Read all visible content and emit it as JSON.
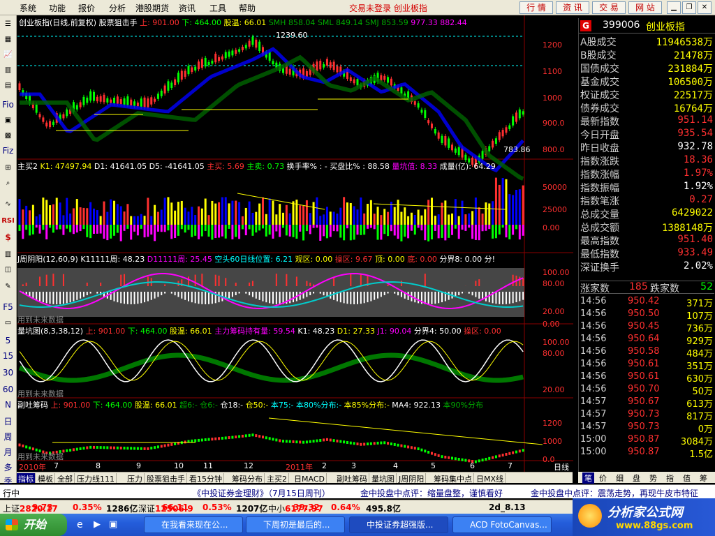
{
  "menu": [
    "系统",
    "功能",
    "报价",
    "分析",
    "港股期货",
    "资讯",
    "工具",
    "帮助"
  ],
  "status_center": "交易未登录  创业板指",
  "top_buttons": [
    "行 情",
    "资 讯",
    "交 易",
    "网 站"
  ],
  "left_toolbar": [
    "Fio",
    "Fiz",
    "RSI",
    "$",
    "F5",
    "5",
    "15",
    "30",
    "60",
    "N",
    "日",
    "周",
    "月",
    "多",
    "季"
  ],
  "panels": {
    "p1": {
      "title": "创业板指(日线,前复权)",
      "indicator": "股票狙击手",
      "up": "上: 901.00",
      "down": "下: 464.00",
      "mid": "股温: 66.01",
      "smh": "SMH 858.04",
      "sml": "SML 849.14",
      "smj": "SMJ 853.59",
      "v1": "977.33",
      "v2": "882.44",
      "high_label": "1239.60",
      "low_label": "783.86"
    },
    "p2": {
      "title": "主买2",
      "k1": "K1: 47497.94",
      "d1": "D1: 41641.05",
      "d5": "D5: -41641.05",
      "zm": "主买: 5.69",
      "zmai": "主卖: 0.73",
      "hsl": "换手率% : -",
      "mpb": "买盘比% : 88.58",
      "lkz": "量坑值: 8.33",
      "cl": "成量(亿): 64.29"
    },
    "p3": {
      "title": "J周阴阳(12,60,9)",
      "k": "K11111周: 48.23",
      "d": "D11111周: 25.45",
      "kt": "空头60日线位置: 6.21",
      "gq": "观区: 0.00",
      "cq": "操区: 9.67",
      "ding": "顶: 0.00",
      "di": "底: 0.00",
      "fj": "分界8: 0.00",
      "fen": "分!",
      "note": "用到未来数据"
    },
    "p4": {
      "title": "量坑图(8,3,38,12)",
      "up": "上: 901.00",
      "down": "下: 464.00",
      "mid": "股温: 66.01",
      "zl": "主力筹码持有量: 59.54",
      "k1": "K1: 48.23",
      "d1": "D1: 27.33",
      "j1": "J1: 90.04",
      "fj": "分界4: 50.00",
      "cq": "操区: 0.00",
      "note": "用到未来数据"
    },
    "p5": {
      "title": "副吐筹码",
      "up": "上: 901.00",
      "down": "下: 464.00",
      "mid": "股温: 66.01",
      "c1": "超6:-",
      "c2": "仓6:-",
      "c3": "仓18:-",
      "c4": "仓50:-",
      "c5": "本75:-",
      "c6": "本80%分布:-",
      "c7": "本85%分布:-",
      "ma": "MA4: 922.13",
      "c8": "本90%分布",
      "note": "用到未来数据"
    }
  },
  "y_axis": {
    "p1": [
      "1200",
      "1100",
      "1000",
      "900.0",
      "800.0"
    ],
    "p2": [
      "50000",
      "25000",
      "0.00"
    ],
    "p3": [
      "100.00",
      "80.00",
      "20.00",
      "0.00"
    ],
    "p4": [
      "100.00",
      "80.00",
      "20.00"
    ],
    "p5": [
      "1200",
      "1000",
      "0.0"
    ]
  },
  "x_axis": {
    "year": "2010年",
    "labels": [
      "7",
      "8",
      "9",
      "10",
      "11",
      "12",
      "2011年",
      "2",
      "3",
      "4",
      "5",
      "6",
      "7"
    ],
    "period": "日线"
  },
  "index_panel": {
    "header_icon": "G",
    "code": "399006",
    "name": "创业板指",
    "rows": [
      {
        "k": "A股成交",
        "v": "11946538万",
        "c": "#ffff00"
      },
      {
        "k": "B股成交",
        "v": "21478万",
        "c": "#ffff00"
      },
      {
        "k": "国债成交",
        "v": "231884万",
        "c": "#ffff00"
      },
      {
        "k": "基金成交",
        "v": "106500万",
        "c": "#ffff00"
      },
      {
        "k": "权证成交",
        "v": "22517万",
        "c": "#ffff00"
      },
      {
        "k": "债券成交",
        "v": "16764万",
        "c": "#ffff00"
      },
      {
        "k": "最新指数",
        "v": "951.14",
        "c": "#ff3030"
      },
      {
        "k": "今日开盘",
        "v": "935.54",
        "c": "#ff3030"
      },
      {
        "k": "昨日收盘",
        "v": "932.78",
        "c": "#ffffff"
      },
      {
        "k": "指数涨跌",
        "v": "18.36",
        "c": "#ff3030"
      },
      {
        "k": "指数涨幅",
        "v": "1.97%",
        "c": "#ff3030"
      },
      {
        "k": "指数振幅",
        "v": "1.92%",
        "c": "#ffffff"
      },
      {
        "k": "指数笔涨",
        "v": "0.27",
        "c": "#ff3030"
      },
      {
        "k": "总成交量",
        "v": "6429022",
        "c": "#ffff00"
      },
      {
        "k": "总成交额",
        "v": "1388148万",
        "c": "#ffff00"
      },
      {
        "k": "最高指数",
        "v": "951.40",
        "c": "#ff3030"
      },
      {
        "k": "最低指数",
        "v": "933.49",
        "c": "#ff3030"
      },
      {
        "k": "深证换手",
        "v": "2.02%",
        "c": "#ffffff"
      }
    ],
    "rise_label": "涨家数",
    "rise": "185",
    "fall_label": "跌家数",
    "fall": "52",
    "ticks": [
      {
        "t": "14:56",
        "p": "950.42",
        "q": "371万"
      },
      {
        "t": "14:56",
        "p": "950.50",
        "q": "107万"
      },
      {
        "t": "14:56",
        "p": "950.45",
        "q": "736万"
      },
      {
        "t": "14:56",
        "p": "950.64",
        "q": "929万"
      },
      {
        "t": "14:56",
        "p": "950.58",
        "q": "484万"
      },
      {
        "t": "14:56",
        "p": "950.61",
        "q": "351万"
      },
      {
        "t": "14:56",
        "p": "950.61",
        "q": "630万"
      },
      {
        "t": "14:56",
        "p": "950.70",
        "q": "50万"
      },
      {
        "t": "14:57",
        "p": "950.67",
        "q": "613万"
      },
      {
        "t": "14:57",
        "p": "950.73",
        "q": "817万"
      },
      {
        "t": "14:57",
        "p": "950.73",
        "q": "0万"
      },
      {
        "t": "15:00",
        "p": "950.87",
        "q": "3084万"
      },
      {
        "t": "15:00",
        "p": "950.87",
        "q": "1.5亿"
      }
    ]
  },
  "tabs": [
    "指标",
    "模板",
    "全部",
    "压力线111",
    "压力",
    "股票狙击手",
    "看15分钟",
    "筹码分布",
    "主买2",
    "日MACD",
    "副吐筹码",
    "量坑图",
    "J周阴阳",
    "筹码集中点",
    "日MX线"
  ],
  "right_tabs": [
    "笔",
    "价",
    "细",
    "盘",
    "势",
    "指",
    "值",
    "筹"
  ],
  "nav_arrows": [
    "+",
    "-",
    "◀",
    "▶",
    "◀",
    "▶"
  ],
  "news": {
    "left": "行中",
    "center": "《中投证券金理财》（7月15日周刊）",
    "mid": "金中投盘中点评：缩量盘整，谨慎看好",
    "right": "金中投盘中点评：震荡走势，再现牛皮市特征"
  },
  "quotes": [
    {
      "k": "上证",
      "v": "2820.17",
      "c": "#ff0000"
    },
    {
      "k": "",
      "v": "9.73",
      "c": "#ff0000"
    },
    {
      "k": "",
      "v": "0.35%",
      "c": "#ff0000"
    },
    {
      "k": "",
      "v": "1286亿",
      "c": "#000000"
    },
    {
      "k": "深证",
      "v": "12506.9",
      "c": "#ff0000"
    },
    {
      "k": "",
      "v": "66.11",
      "c": "#ff0000"
    },
    {
      "k": "",
      "v": "0.53%",
      "c": "#ff0000"
    },
    {
      "k": "",
      "v": "1207亿",
      "c": "#000000"
    },
    {
      "k": "中小",
      "v": "6177.97",
      "c": "#ff0000"
    },
    {
      "k": "",
      "v": "39.32",
      "c": "#ff0000"
    },
    {
      "k": "",
      "v": "0.64%",
      "c": "#ff0000"
    },
    {
      "k": "",
      "v": "495.8亿",
      "c": "#000000"
    },
    {
      "k": "",
      "v": "2d_8.13",
      "c": "#000000"
    }
  ],
  "taskbar": {
    "start": "开始",
    "tasks": [
      "在我看来现在公...",
      "下周初是最后的...",
      "中投证券超强版...",
      "ACD FotoCanvas..."
    ]
  },
  "logo": {
    "title": "分析家公式网",
    "url": "www.88gs.com"
  }
}
